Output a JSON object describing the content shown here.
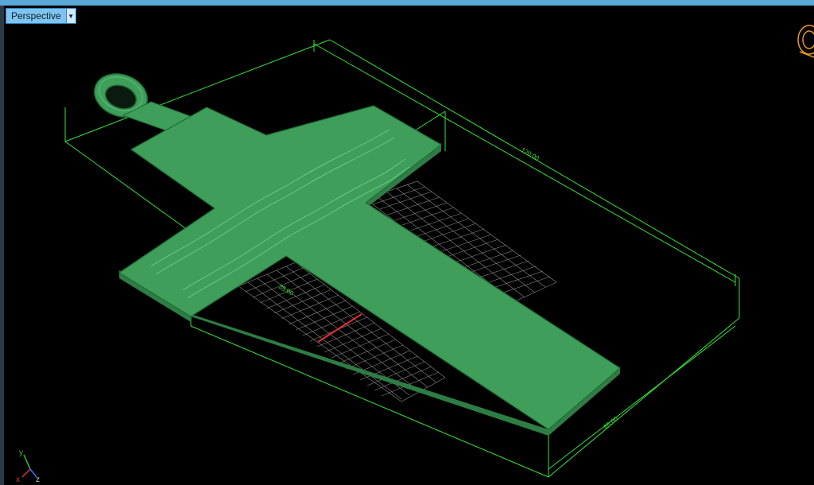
{
  "viewport": {
    "label": "Perspective",
    "dropdown_icon": "triangle-down-icon"
  },
  "dimensions": {
    "length": "120.00",
    "width": "65.00",
    "inner": "35.00"
  },
  "axes": {
    "y": "y",
    "x": "x",
    "z": "z"
  },
  "colors": {
    "model": "#3e9e5a",
    "model_edge": "#1f6e35",
    "dimension_lines": "#35e335",
    "grid": "#8a8a8a",
    "axis_red": "#e03030",
    "viewcube": "#e89a2a"
  }
}
